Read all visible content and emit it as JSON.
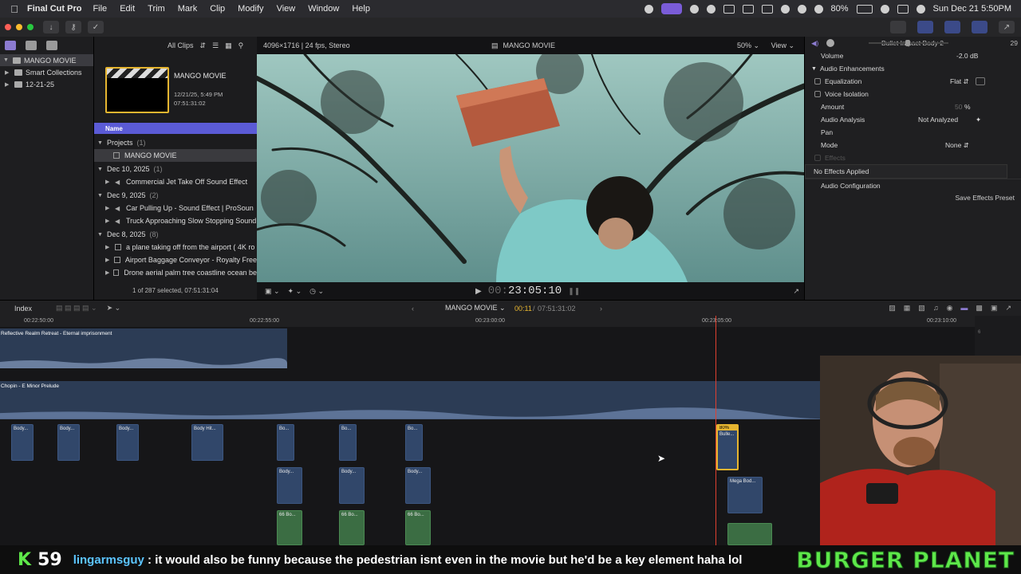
{
  "menubar": {
    "app": "Final Cut Pro",
    "items": [
      "File",
      "Edit",
      "Trim",
      "Mark",
      "Clip",
      "Modify",
      "View",
      "Window",
      "Help"
    ],
    "battery": "80%",
    "datetime": "Sun Dec 21  5:50PM"
  },
  "library": {
    "root": "MANGO MOVIE",
    "items": [
      "Smart Collections",
      "12-21-25"
    ]
  },
  "browser": {
    "filter": "All Clips",
    "project": {
      "title": "MANGO MOVIE",
      "date": "12/21/25, 5:49 PM",
      "duration": "07:51:31:02"
    },
    "name_header": "Name",
    "groups": [
      {
        "label": "Projects",
        "count": "(1)",
        "items": [
          {
            "name": "MANGO MOVIE",
            "type": "project"
          }
        ]
      },
      {
        "label": "Dec 10, 2025",
        "count": "(1)",
        "items": [
          {
            "name": "Commercial Jet Take Off Sound Effect",
            "type": "audio"
          }
        ]
      },
      {
        "label": "Dec 9, 2025",
        "count": "(2)",
        "items": [
          {
            "name": "Car Pulling Up - Sound Effect  |  ProSoun",
            "type": "audio"
          },
          {
            "name": "Truck Approaching Slow Stopping Sound",
            "type": "audio"
          }
        ]
      },
      {
        "label": "Dec 8, 2025",
        "count": "(8)",
        "items": [
          {
            "name": "a plane taking off from the airport ( 4K ro",
            "type": "video"
          },
          {
            "name": "Airport Baggage Conveyor - Royalty Free",
            "type": "video"
          },
          {
            "name": "Drone aerial palm tree coastline ocean be",
            "type": "video"
          }
        ]
      }
    ],
    "status": "1 of 287 selected, 07:51:31:04"
  },
  "viewer": {
    "format": "4096×1716 | 24 fps, Stereo",
    "title": "MANGO MOVIE",
    "zoom": "50%",
    "view": "View",
    "timecode": "23:05:10",
    "timecode_prefix": "00:"
  },
  "inspector": {
    "clip_title": "Bullet Impact Body 2",
    "clip_duration": "29",
    "volume_label": "Volume",
    "volume_value": "-2.0  dB",
    "audio_enhancements": "Audio Enhancements",
    "equalization": "Equalization",
    "equalization_value": "Flat",
    "voice_isolation": "Voice Isolation",
    "amount": "Amount",
    "amount_value": "50",
    "amount_unit": "%",
    "audio_analysis": "Audio Analysis",
    "audio_analysis_value": "Not Analyzed",
    "pan": "Pan",
    "mode": "Mode",
    "mode_value": "None",
    "effects": "Effects",
    "no_effects": "No Effects Applied",
    "audio_config": "Audio Configuration",
    "save_preset": "Save Effects Preset"
  },
  "timeline_bar": {
    "index": "Index",
    "project": "MANGO MOVIE",
    "position": "00:11",
    "total": "07:51:31:02"
  },
  "timeline": {
    "ruler": [
      "00:22:50:00",
      "00:22:55:00",
      "00:23:00:00",
      "00:23:05:00",
      "00:23:10:00"
    ],
    "lane1_title": "Reflective Realm Retreat - Eternal imprisonment",
    "lane2_title": "Chopin - E Minor Prelude",
    "clips_row1": [
      "Body...",
      "Body...",
      "Body...",
      "Body Hit...",
      "Bo...",
      "Bo...",
      "Bo..."
    ],
    "clips_row2": [
      "Body...",
      "Body...",
      "Body..."
    ],
    "clips_row3": [
      "66 Bo...",
      "66 Bo...",
      "66 Bo..."
    ],
    "selected_clip_label": "Bulle...",
    "selected_clip_badge": "80%",
    "mega_clip": "Mega Bod...",
    "meter_ticks": [
      "6",
      "0",
      "-6"
    ]
  },
  "overlay": {
    "k_label": "K",
    "k_count": "59",
    "chat_user": "lingarmsguy",
    "chat_message": " : it would also be funny because the pedestrian isnt even in the movie but he'd be a key element haha lol",
    "brand": "BURGER PLANET"
  },
  "colors": {
    "accent": "#5b5bd6",
    "playhead": "#e04030",
    "selected_clip": "#e6b530",
    "green_text": "#5ee84a",
    "chat_user": "#5cc5ff"
  }
}
